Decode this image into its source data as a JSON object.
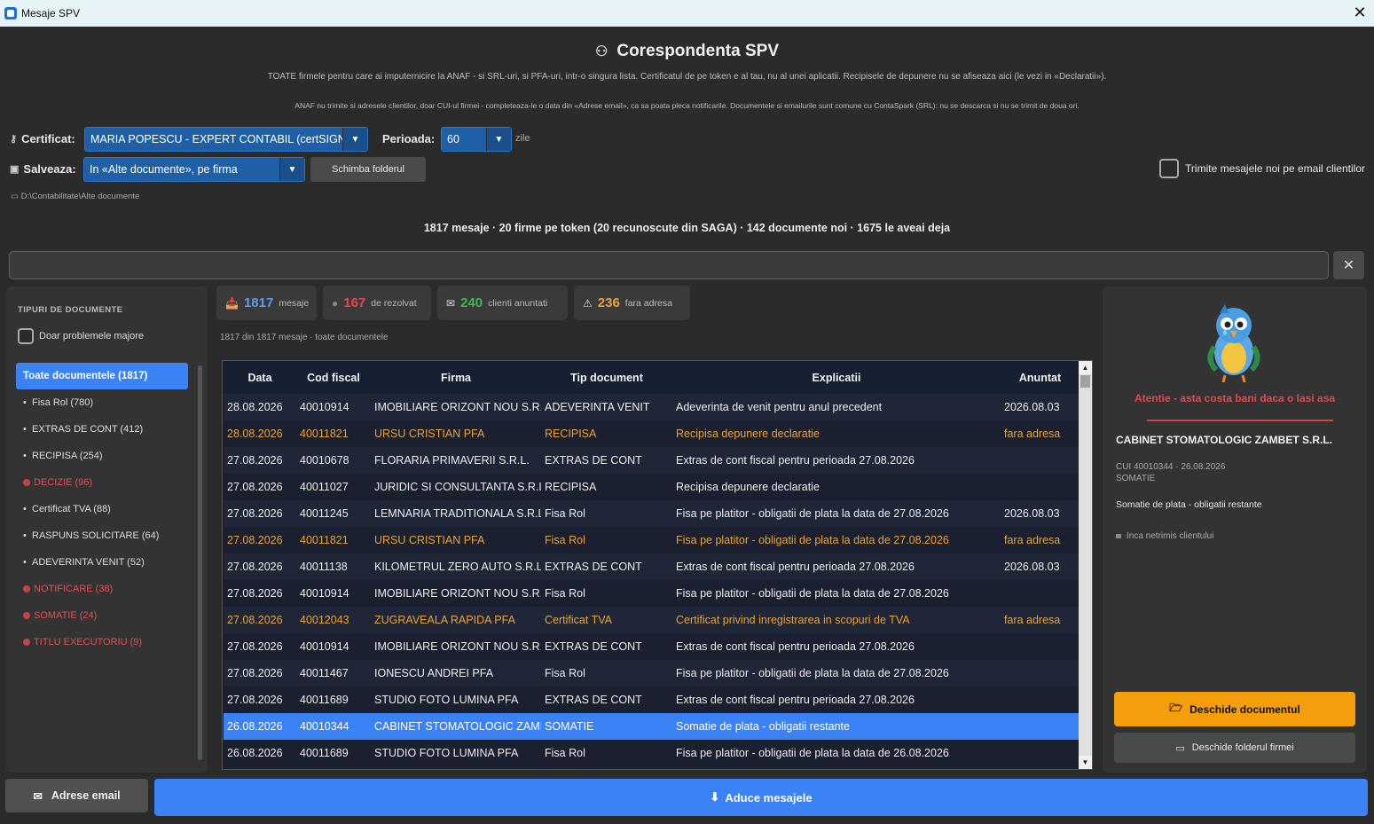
{
  "window": {
    "title": "Mesaje SPV",
    "close_glyph": "✕"
  },
  "header": {
    "title": "Corespondenta SPV",
    "description1": "TOATE firmele pentru care ai imputernicire la ANAF - si SRL-uri, si PFA-uri, intr-o singura lista. Certificatul de pe token e al tau, nu al unei aplicatii. Recipisele de depunere nu se afiseaza aici (le vezi in «Declaratii»).",
    "description2": "ANAF nu trimite si adresele clientilor, doar CUI-ul firmei - completeaza-le o data din «Adrese email», ca sa poata pleca notificarile. Documentele si emailurile sunt comune cu ContaSpark (SRL): nu se descarca si nu se trimit de doua ori."
  },
  "controls": {
    "certificate_label": "Certificat:",
    "certificate_value": "MARIA POPESCU - EXPERT CONTABIL (certSIGN)",
    "period_label": "Perioada:",
    "period_value": "60",
    "period_unit": "zile",
    "save_label": "Salveaza:",
    "save_value": "In «Alte documente», pe firma",
    "change_folder": "Schimba folderul",
    "email_toggle": "Trimite mesajele noi pe email clientilor",
    "path": "D:\\Contabilitate\\Alte documente"
  },
  "stats_line": "1817 mesaje · 20 firme pe token (20 recunoscute din SAGA) · 142 documente noi · 1675 le aveai deja",
  "search": {
    "value": "",
    "clear_glyph": "✕"
  },
  "sidebar": {
    "heading": "TIPURI DE DOCUMENTE",
    "only_major": "Doar problemele majore",
    "items": [
      {
        "label": "Toate documentele  (1817)",
        "kind": "active"
      },
      {
        "label": "Fisa Rol  (780)",
        "kind": "normal"
      },
      {
        "label": "EXTRAS DE CONT  (412)",
        "kind": "normal"
      },
      {
        "label": "RECIPISA  (254)",
        "kind": "normal"
      },
      {
        "label": "DECIZIE  (96)",
        "kind": "red"
      },
      {
        "label": "Certificat TVA  (88)",
        "kind": "normal"
      },
      {
        "label": "RASPUNS SOLICITARE  (64)",
        "kind": "normal"
      },
      {
        "label": "ADEVERINTA VENIT  (52)",
        "kind": "normal"
      },
      {
        "label": "NOTIFICARE  (38)",
        "kind": "red"
      },
      {
        "label": "SOMATIE  (24)",
        "kind": "red"
      },
      {
        "label": "TITLU EXECUTORIU  (9)",
        "kind": "red"
      }
    ]
  },
  "kpis": [
    {
      "number": "1817",
      "label": "mesaje",
      "color": "#5b9bf0",
      "icon": "inbox-icon",
      "glyph": "📥"
    },
    {
      "number": "167",
      "label": "de rezolvat",
      "color": "#e5484d",
      "icon": "dot-icon",
      "glyph": "●"
    },
    {
      "number": "240",
      "label": "clienti anuntati",
      "color": "#3fb950",
      "icon": "mail-icon",
      "glyph": "✉"
    },
    {
      "number": "236",
      "label": "fara adresa",
      "color": "#e9a23b",
      "icon": "warning-icon",
      "glyph": "⚠"
    }
  ],
  "result_note": "1817 din 1817 mesaje  ·  toate documentele",
  "table": {
    "headers": [
      "Data",
      "Cod fiscal",
      "Firma",
      "Tip document",
      "Explicatii",
      "Anuntat"
    ],
    "rows": [
      {
        "style": "odd",
        "cells": [
          "28.08.2026",
          "40010914",
          "IMOBILIARE ORIZONT NOU S.R.",
          "ADEVERINTA VENIT",
          "Adeverinta de venit pentru anul precedent",
          "2026.08.03"
        ]
      },
      {
        "style": "even warn",
        "cells": [
          "28.08.2026",
          "40011821",
          "URSU CRISTIAN PFA",
          "RECIPISA",
          "Recipisa depunere declaratie",
          "fara adresa"
        ]
      },
      {
        "style": "odd",
        "cells": [
          "27.08.2026",
          "40010678",
          "FLORARIA PRIMAVERII S.R.L.",
          "EXTRAS DE CONT",
          "Extras de cont fiscal pentru perioada 27.08.2026",
          ""
        ]
      },
      {
        "style": "even",
        "cells": [
          "27.08.2026",
          "40011027",
          "JURIDIC SI CONSULTANTA S.R.L",
          "RECIPISA",
          "Recipisa depunere declaratie",
          ""
        ]
      },
      {
        "style": "odd",
        "cells": [
          "27.08.2026",
          "40011245",
          "LEMNARIA TRADITIONALA S.R.L",
          "Fisa Rol",
          "Fisa pe platitor - obligatii de plata la data de 27.08.2026",
          "2026.08.03"
        ]
      },
      {
        "style": "even warn",
        "cells": [
          "27.08.2026",
          "40011821",
          "URSU CRISTIAN PFA",
          "Fisa Rol",
          "Fisa pe platitor - obligatii de plata la data de 27.08.2026",
          "fara adresa"
        ]
      },
      {
        "style": "odd",
        "cells": [
          "27.08.2026",
          "40011138",
          "KILOMETRUL ZERO AUTO S.R.L.",
          "EXTRAS DE CONT",
          "Extras de cont fiscal pentru perioada 27.08.2026",
          "2026.08.03"
        ]
      },
      {
        "style": "even",
        "cells": [
          "27.08.2026",
          "40010914",
          "IMOBILIARE ORIZONT NOU S.R.",
          "Fisa Rol",
          "Fisa pe platitor - obligatii de plata la data de 27.08.2026",
          ""
        ]
      },
      {
        "style": "odd warn",
        "cells": [
          "27.08.2026",
          "40012043",
          "ZUGRAVEALA RAPIDA PFA",
          "Certificat TVA",
          "Certificat privind inregistrarea in scopuri de TVA",
          "fara adresa"
        ]
      },
      {
        "style": "even",
        "cells": [
          "27.08.2026",
          "40010914",
          "IMOBILIARE ORIZONT NOU S.R.",
          "EXTRAS DE CONT",
          "Extras de cont fiscal pentru perioada 27.08.2026",
          ""
        ]
      },
      {
        "style": "odd",
        "cells": [
          "27.08.2026",
          "40011467",
          "IONESCU ANDREI PFA",
          "Fisa Rol",
          "Fisa pe platitor - obligatii de plata la data de 27.08.2026",
          ""
        ]
      },
      {
        "style": "even",
        "cells": [
          "27.08.2026",
          "40011689",
          "STUDIO FOTO LUMINA PFA",
          "EXTRAS DE CONT",
          "Extras de cont fiscal pentru perioada 27.08.2026",
          ""
        ]
      },
      {
        "style": "sel",
        "cells": [
          "26.08.2026",
          "40010344",
          "CABINET STOMATOLOGIC ZAMI",
          "SOMATIE",
          "Somatie de plata - obligatii restante",
          ""
        ]
      },
      {
        "style": "even",
        "cells": [
          "26.08.2026",
          "40011689",
          "STUDIO FOTO LUMINA PFA",
          "Fisa Rol",
          "Fisa pe platitor - obligatii de plata la data de 26.08.2026",
          ""
        ]
      }
    ]
  },
  "detail": {
    "warning": "Atentie - asta costa bani daca o lasi asa",
    "firm": "CABINET STOMATOLOGIC ZAMBET S.R.L.",
    "meta": "CUI 40010344   ·   26.08.2026",
    "doc_type": "SOMATIE",
    "explanation": "Somatie de plata - obligatii restante",
    "status": "Inca netrimis clientului",
    "open_button": "Deschide documentul",
    "folder_button": "Deschide folderul firmei"
  },
  "footer": {
    "emails_button": "Adrese email",
    "fetch_button": "Aduce mesajele"
  },
  "colors": {
    "accent": "#3b82f6",
    "warning_orange": "#e9a23b",
    "danger_red": "#e5484d",
    "open_button": "#f59e0b"
  }
}
